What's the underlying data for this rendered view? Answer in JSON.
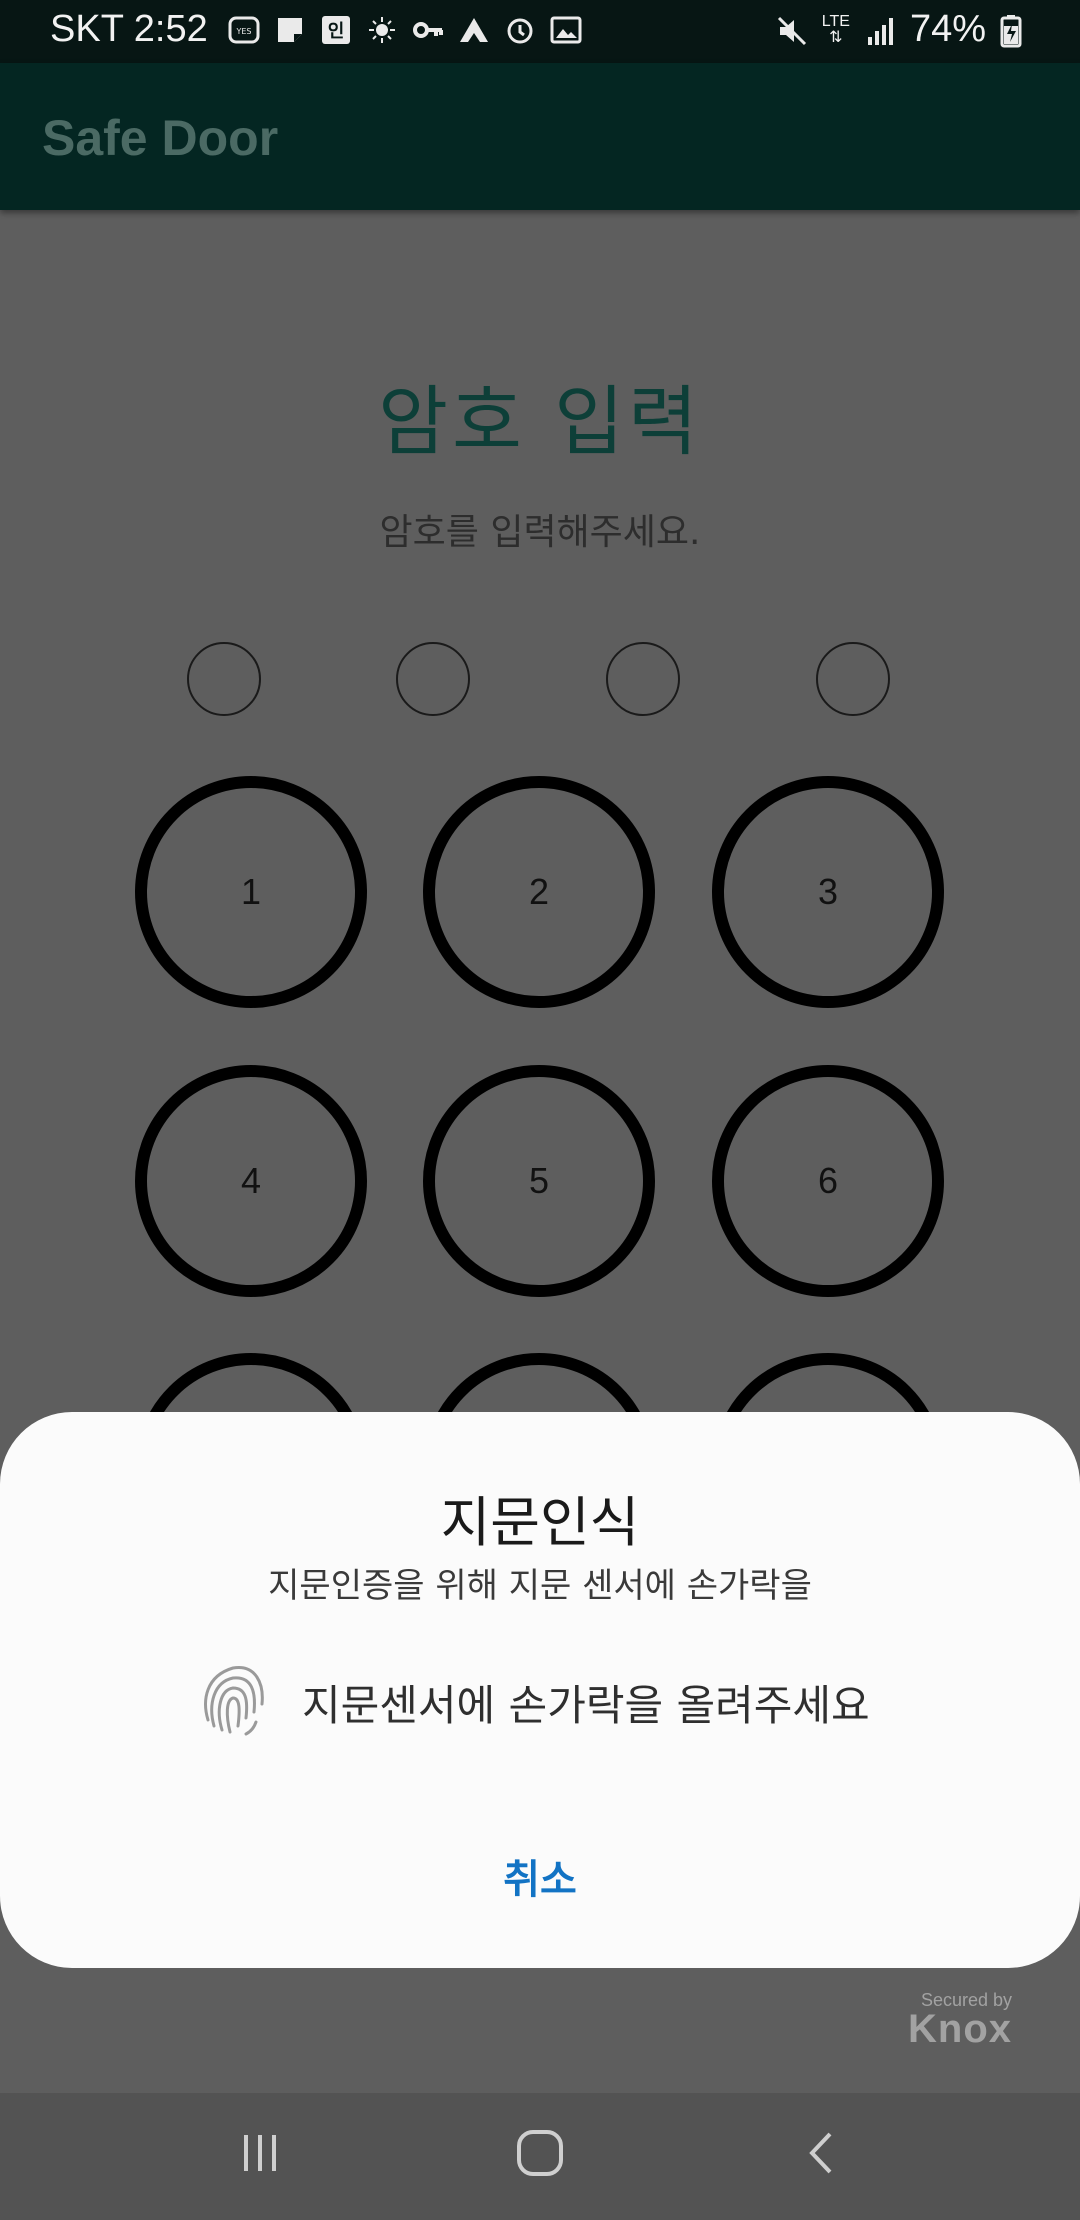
{
  "status_bar": {
    "carrier_time": "SKT 2:52",
    "network": "LTE",
    "battery": "74%",
    "left_icons": [
      "yes24-icon",
      "memo-icon",
      "in-badge-icon",
      "weather-icon",
      "key-icon",
      "mountain-icon",
      "alarm-icon",
      "image-icon"
    ],
    "right_icons": [
      "mute-icon",
      "lte-icon",
      "signal-icon",
      "battery-charging-icon"
    ]
  },
  "app_bar": {
    "title": "Safe Door"
  },
  "pin_screen": {
    "title": "암호 입력",
    "subtitle": "암호를 입력해주세요.",
    "pin_length": 4,
    "keys": [
      "1",
      "2",
      "3",
      "4",
      "5",
      "6"
    ]
  },
  "fingerprint_dialog": {
    "title": "지문인식",
    "subtitle": "지문인증을 위해 지문 센서에 손가락을",
    "prompt": "지문센서에 손가락을 올려주세요",
    "cancel_label": "취소"
  },
  "knox": {
    "secured_by": "Secured by",
    "brand": "Knox"
  },
  "nav_bar": {
    "buttons": [
      "recents-icon",
      "home-icon",
      "back-icon"
    ]
  },
  "colors": {
    "app_bar": "#042622",
    "title_accent": "#0d3f38",
    "cancel_blue": "#1273c4",
    "scrim_background": "#5e5e5e"
  }
}
